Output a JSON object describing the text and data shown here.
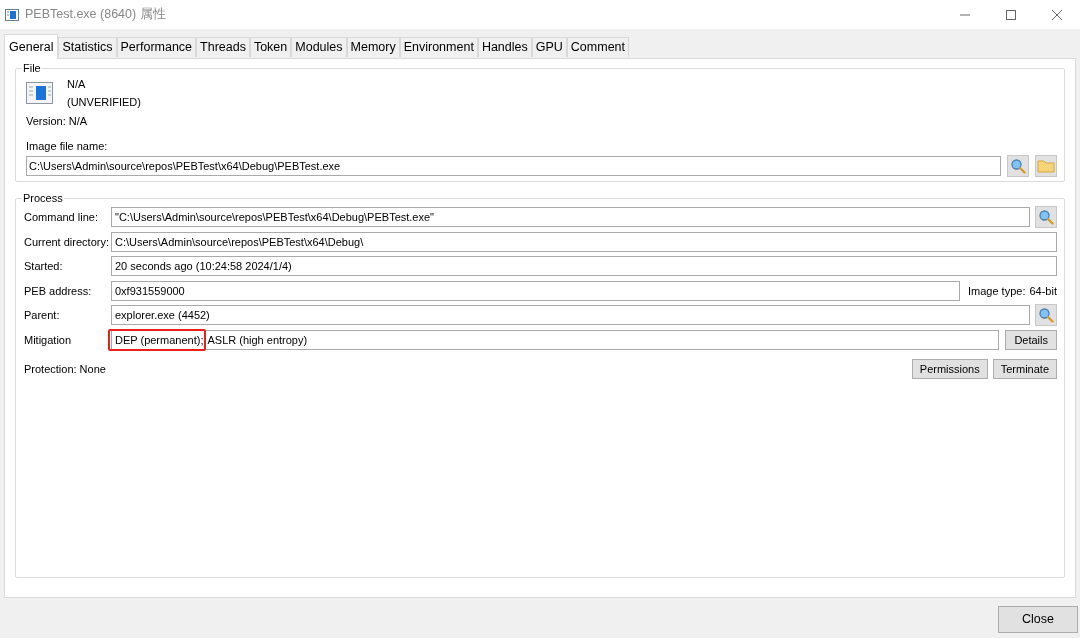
{
  "window": {
    "title": "PEBTest.exe (8640) 属性"
  },
  "tabs": [
    {
      "label": "General",
      "selected": true
    },
    {
      "label": "Statistics",
      "selected": false
    },
    {
      "label": "Performance",
      "selected": false
    },
    {
      "label": "Threads",
      "selected": false
    },
    {
      "label": "Token",
      "selected": false
    },
    {
      "label": "Modules",
      "selected": false
    },
    {
      "label": "Memory",
      "selected": false
    },
    {
      "label": "Environment",
      "selected": false
    },
    {
      "label": "Handles",
      "selected": false
    },
    {
      "label": "GPU",
      "selected": false
    },
    {
      "label": "Comment",
      "selected": false
    }
  ],
  "file_group": {
    "title": "File",
    "name": "N/A",
    "verification": "(UNVERIFIED)",
    "version_label": "Version:",
    "version": "N/A",
    "image_label": "Image file name:",
    "image_path": "C:\\Users\\Admin\\source\\repos\\PEBTest\\x64\\Debug\\PEBTest.exe"
  },
  "process_group": {
    "title": "Process",
    "rows": [
      {
        "label": "Command line:",
        "segments": [
          {
            "text": "\"C:\\Users\\Admin\\source\\repos\\PEBTest\\x64\\Debug\\PEBTest.exe\"",
            "highlighted": false
          }
        ],
        "action": {
          "kind": "search"
        }
      },
      {
        "label": "Current directory:",
        "segments": [
          {
            "text": "C:\\Users\\Admin\\source\\repos\\PEBTest\\x64\\Debug\\",
            "highlighted": false
          }
        ]
      },
      {
        "label": "Started:",
        "segments": [
          {
            "text": "20 seconds ago (10:24:58 2024/1/4)",
            "highlighted": false
          }
        ]
      },
      {
        "label": "PEB address:",
        "segments": [
          {
            "text": "0xf931559000",
            "highlighted": false
          }
        ],
        "action": {
          "kind": "info",
          "label": "Image type:",
          "value": "64-bit"
        }
      },
      {
        "label": "Parent:",
        "segments": [
          {
            "text": "explorer.exe (4452)",
            "highlighted": false
          }
        ],
        "action": {
          "kind": "search"
        }
      },
      {
        "label": "Mitigation",
        "segments": [
          {
            "text": "DEP (permanent);",
            "highlighted": true
          },
          {
            "text": "ASLR (high entropy)",
            "highlighted": false
          }
        ],
        "action": {
          "kind": "button",
          "label": "Details"
        }
      }
    ],
    "protection_label": "Protection:",
    "protection": "None",
    "buttons": [
      "Permissions",
      "Terminate"
    ]
  },
  "footer": {
    "close_button": "Close"
  }
}
